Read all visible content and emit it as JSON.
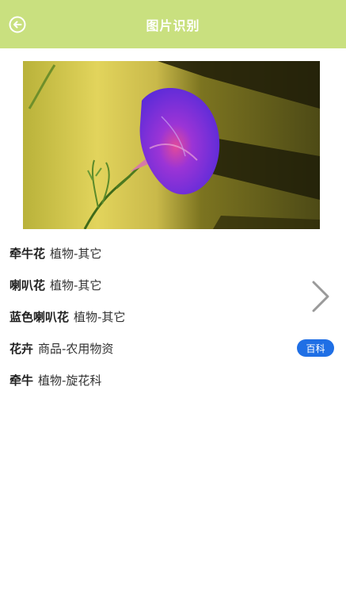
{
  "header": {
    "title": "图片识别",
    "background": "#c9e07f"
  },
  "photo": {
    "subject": "purple morning glory flower"
  },
  "results": [
    {
      "name": "牵牛花",
      "category": "植物-其它"
    },
    {
      "name": "喇叭花",
      "category": "植物-其它"
    },
    {
      "name": "蓝色喇叭花",
      "category": "植物-其它"
    },
    {
      "name": "花卉",
      "category": "商品-农用物资",
      "badge": "百科"
    },
    {
      "name": "牵牛",
      "category": "植物-旋花科"
    }
  ],
  "icons": {
    "back": "back-circle-arrow-icon",
    "next": "chevron-right-icon"
  },
  "badge_color": "#1f6fe5"
}
